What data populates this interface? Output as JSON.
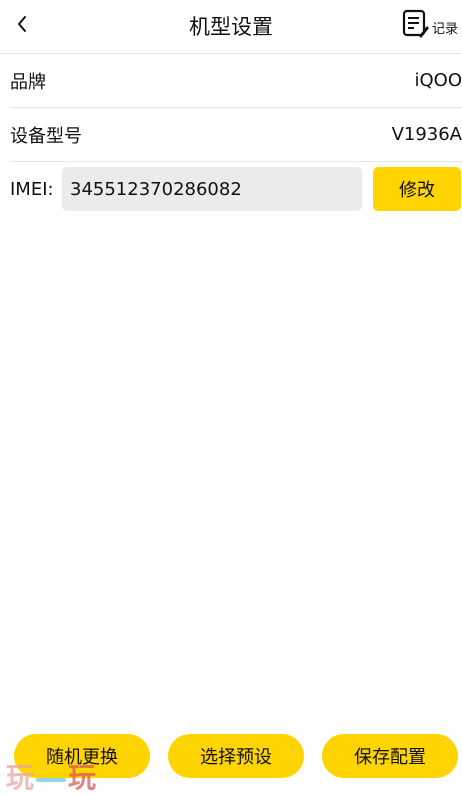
{
  "header": {
    "title": "机型设置",
    "record_label": "记录",
    "back_icon": "chevron-left-icon",
    "record_icon": "document-edit-icon"
  },
  "device": {
    "brand_label": "品牌",
    "brand_value": "iQOO",
    "model_label": "设备型号",
    "model_value": "V1936A",
    "imei_label": "IMEI:",
    "imei_value": "345512370286082",
    "edit_label": "修改"
  },
  "actions": {
    "random_label": "随机更换",
    "preset_label": "选择预设",
    "save_label": "保存配置"
  },
  "watermark": {
    "left_glyph": "玩",
    "right_glyph": "玩"
  },
  "colors": {
    "accent": "#ffd400",
    "input_bg": "#ebebeb",
    "divider": "#e6e6e6"
  }
}
